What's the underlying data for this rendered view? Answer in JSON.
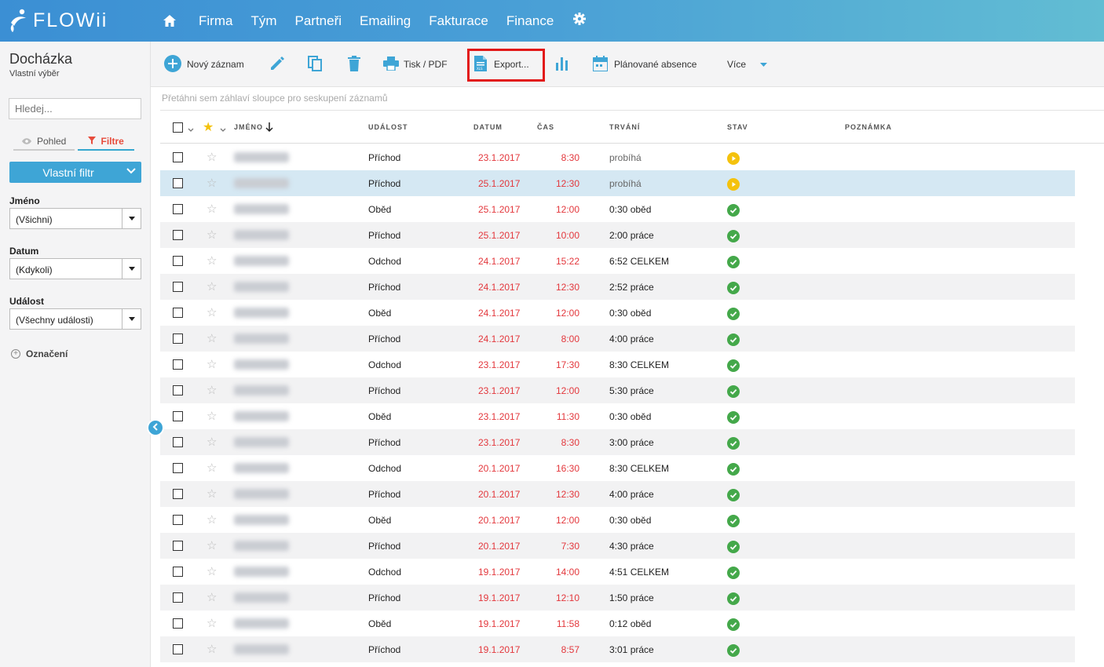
{
  "app": {
    "logo_text": "FLOWii",
    "nav": [
      "Firma",
      "Tým",
      "Partneři",
      "Emailing",
      "Fakturace",
      "Finance"
    ],
    "home_icon": "home-icon",
    "settings_icon": "gear-icon"
  },
  "page": {
    "title": "Docházka",
    "subtitle": "Vlastní výběr"
  },
  "sidebar": {
    "search_placeholder": "Hledej...",
    "tab_view": "Pohled",
    "tab_filters": "Filtre",
    "custom_filter": "Vlastní filtr",
    "filters": [
      {
        "label": "Jméno",
        "value": "(Všichni)"
      },
      {
        "label": "Datum",
        "value": "(Kdykoli)"
      },
      {
        "label": "Událost",
        "value": "(Všechny události)"
      }
    ],
    "marked": "Označení"
  },
  "toolbar": {
    "new_record": "Nový záznam",
    "print_pdf": "Tisk / PDF",
    "export": "Export...",
    "planned_absences": "Plánované absence",
    "more": "Více"
  },
  "grid": {
    "group_hint": "Přetáhni sem záhlaví sloupce pro seskupení záznamů",
    "columns": {
      "name": "JMÉNO",
      "event": "UDÁLOST",
      "date": "DATUM",
      "time": "ČAS",
      "duration": "TRVÁNÍ",
      "status": "STAV",
      "note": "POZNÁMKA"
    },
    "rows": [
      {
        "event": "Příchod",
        "date": "23.1.2017",
        "time": "8:30",
        "duration": "probíhá",
        "status": "running"
      },
      {
        "event": "Příchod",
        "date": "25.1.2017",
        "time": "12:30",
        "duration": "probíhá",
        "status": "running"
      },
      {
        "event": "Oběd",
        "date": "25.1.2017",
        "time": "12:00",
        "duration": "0:30 oběd",
        "status": "ok"
      },
      {
        "event": "Příchod",
        "date": "25.1.2017",
        "time": "10:00",
        "duration": "2:00 práce",
        "status": "ok"
      },
      {
        "event": "Odchod",
        "date": "24.1.2017",
        "time": "15:22",
        "duration": "6:52 CELKEM",
        "status": "ok"
      },
      {
        "event": "Příchod",
        "date": "24.1.2017",
        "time": "12:30",
        "duration": "2:52 práce",
        "status": "ok"
      },
      {
        "event": "Oběd",
        "date": "24.1.2017",
        "time": "12:00",
        "duration": "0:30 oběd",
        "status": "ok"
      },
      {
        "event": "Příchod",
        "date": "24.1.2017",
        "time": "8:00",
        "duration": "4:00 práce",
        "status": "ok"
      },
      {
        "event": "Odchod",
        "date": "23.1.2017",
        "time": "17:30",
        "duration": "8:30 CELKEM",
        "status": "ok"
      },
      {
        "event": "Příchod",
        "date": "23.1.2017",
        "time": "12:00",
        "duration": "5:30 práce",
        "status": "ok"
      },
      {
        "event": "Oběd",
        "date": "23.1.2017",
        "time": "11:30",
        "duration": "0:30 oběd",
        "status": "ok"
      },
      {
        "event": "Příchod",
        "date": "23.1.2017",
        "time": "8:30",
        "duration": "3:00 práce",
        "status": "ok"
      },
      {
        "event": "Odchod",
        "date": "20.1.2017",
        "time": "16:30",
        "duration": "8:30 CELKEM",
        "status": "ok"
      },
      {
        "event": "Příchod",
        "date": "20.1.2017",
        "time": "12:30",
        "duration": "4:00 práce",
        "status": "ok"
      },
      {
        "event": "Oběd",
        "date": "20.1.2017",
        "time": "12:00",
        "duration": "0:30 oběd",
        "status": "ok"
      },
      {
        "event": "Příchod",
        "date": "20.1.2017",
        "time": "7:30",
        "duration": "4:30 práce",
        "status": "ok"
      },
      {
        "event": "Odchod",
        "date": "19.1.2017",
        "time": "14:00",
        "duration": "4:51 CELKEM",
        "status": "ok"
      },
      {
        "event": "Příchod",
        "date": "19.1.2017",
        "time": "12:10",
        "duration": "1:50 práce",
        "status": "ok"
      },
      {
        "event": "Oběd",
        "date": "19.1.2017",
        "time": "11:58",
        "duration": "0:12 oběd",
        "status": "ok"
      },
      {
        "event": "Příchod",
        "date": "19.1.2017",
        "time": "8:57",
        "duration": "3:01 práce",
        "status": "ok"
      }
    ],
    "selected_row": 1
  },
  "colors": {
    "accent": "#3ea5d6",
    "date_red": "#e3373c",
    "status_ok": "#44a84a",
    "status_running": "#f4c20d",
    "highlight_box": "#e21919"
  }
}
